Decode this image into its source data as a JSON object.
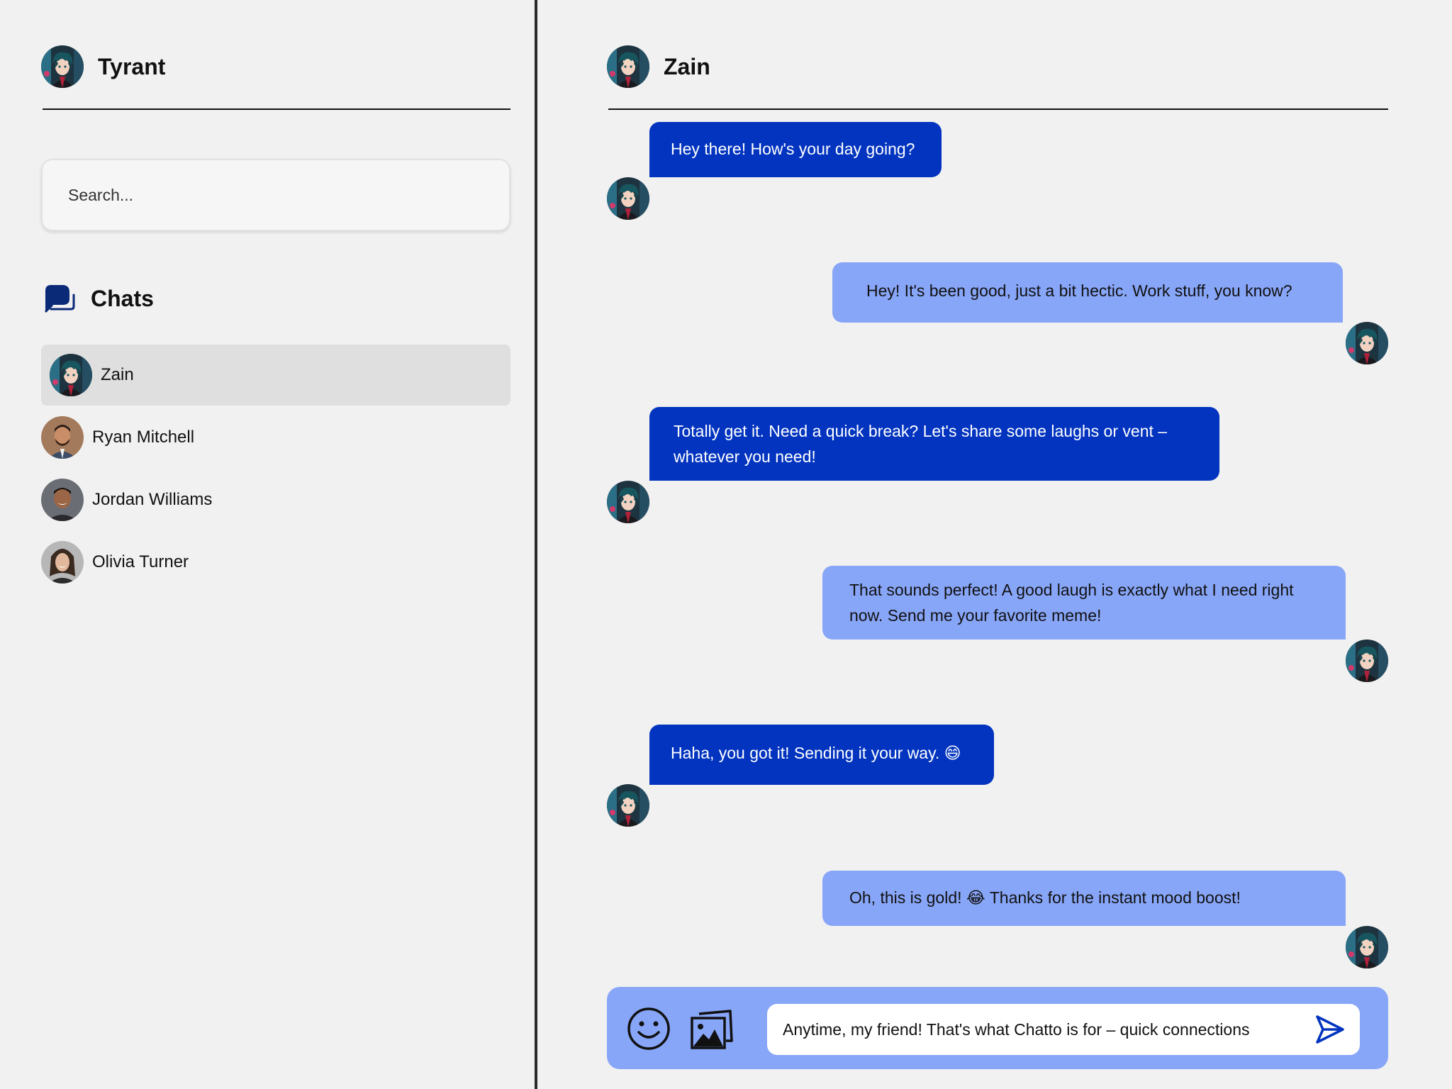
{
  "user": {
    "name": "Tyrant"
  },
  "search": {
    "placeholder": "Search..."
  },
  "chats_section": {
    "title": "Chats"
  },
  "contacts": [
    {
      "name": "Zain",
      "active": true
    },
    {
      "name": "Ryan Mitchell",
      "active": false
    },
    {
      "name": "Jordan Williams",
      "active": false
    },
    {
      "name": "Olivia Turner",
      "active": false
    }
  ],
  "conversation": {
    "contact_name": "Zain",
    "messages": [
      {
        "direction": "in",
        "text": "Hey there! How's your day going?"
      },
      {
        "direction": "out",
        "text": "Hey! It's been good, just a bit hectic. Work stuff, you know?"
      },
      {
        "direction": "in",
        "text": "Totally get it. Need a quick break? Let's share some laughs or vent – whatever you need!"
      },
      {
        "direction": "out",
        "text": "That sounds perfect! A good laugh is exactly what I need right now. Send me your favorite meme!"
      },
      {
        "direction": "in",
        "text": "Haha, you got it! Sending it your way. 😄"
      },
      {
        "direction": "out",
        "text": "Oh, this is gold! 😂 Thanks for the instant mood boost!"
      }
    ]
  },
  "composer": {
    "value": "Anytime, my friend! That's what Chatto is for – quick connections",
    "emoji_icon": "smiley-icon",
    "image_icon": "image-gallery-icon",
    "send_icon": "send-icon"
  },
  "colors": {
    "background": "#f1f1f1",
    "incoming_bubble": "#0234bf",
    "outgoing_bubble": "#88a6f8",
    "composer_bg": "#88a6f8",
    "accent_dark": "#0a2a78"
  }
}
